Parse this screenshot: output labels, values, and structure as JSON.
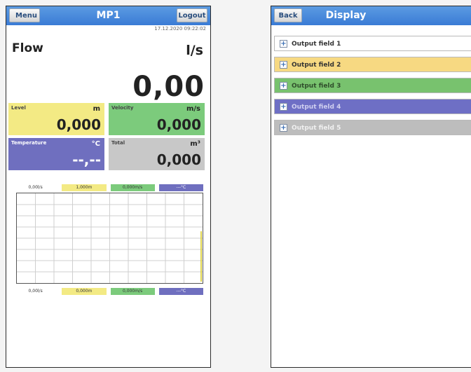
{
  "left_screen": {
    "menu_label": "Menu",
    "title": "MP1",
    "logout_label": "Logout",
    "timestamp": "17.12.2020 09:22:02",
    "flow": {
      "label": "Flow",
      "unit": "l/s",
      "value": "0,00"
    },
    "tiles": {
      "level": {
        "label": "Level",
        "unit": "m",
        "value": "0,000"
      },
      "velocity": {
        "label": "Velocity",
        "unit": "m/s",
        "value": "0,000"
      },
      "temperature": {
        "label": "Temperature",
        "unit": "°C",
        "value": "--,--"
      },
      "total": {
        "label": "Total",
        "unit": "m³",
        "value": "0,000"
      }
    },
    "legend_top": [
      "0,00l/s",
      "1,000m",
      "0,000m/s",
      "---°C"
    ],
    "legend_bottom": [
      "0,00l/s",
      "0,000m",
      "0,000m/s",
      "---°C"
    ]
  },
  "right_screen": {
    "back_label": "Back",
    "title": "Display",
    "output_fields": [
      {
        "label": "Output field 1",
        "color": "#ffffff"
      },
      {
        "label": "Output field 2",
        "color": "#f7d982"
      },
      {
        "label": "Output field 3",
        "color": "#78c26e"
      },
      {
        "label": "Output field 4",
        "color": "#6e6fc5"
      },
      {
        "label": "Output field 5",
        "color": "#bdbdbd"
      }
    ]
  },
  "colors": {
    "titlebar": "#3a7bd5",
    "level": "#f3ea84",
    "velocity": "#7ccb7c",
    "temperature": "#6f6fbf",
    "total": "#c8c8c8"
  }
}
